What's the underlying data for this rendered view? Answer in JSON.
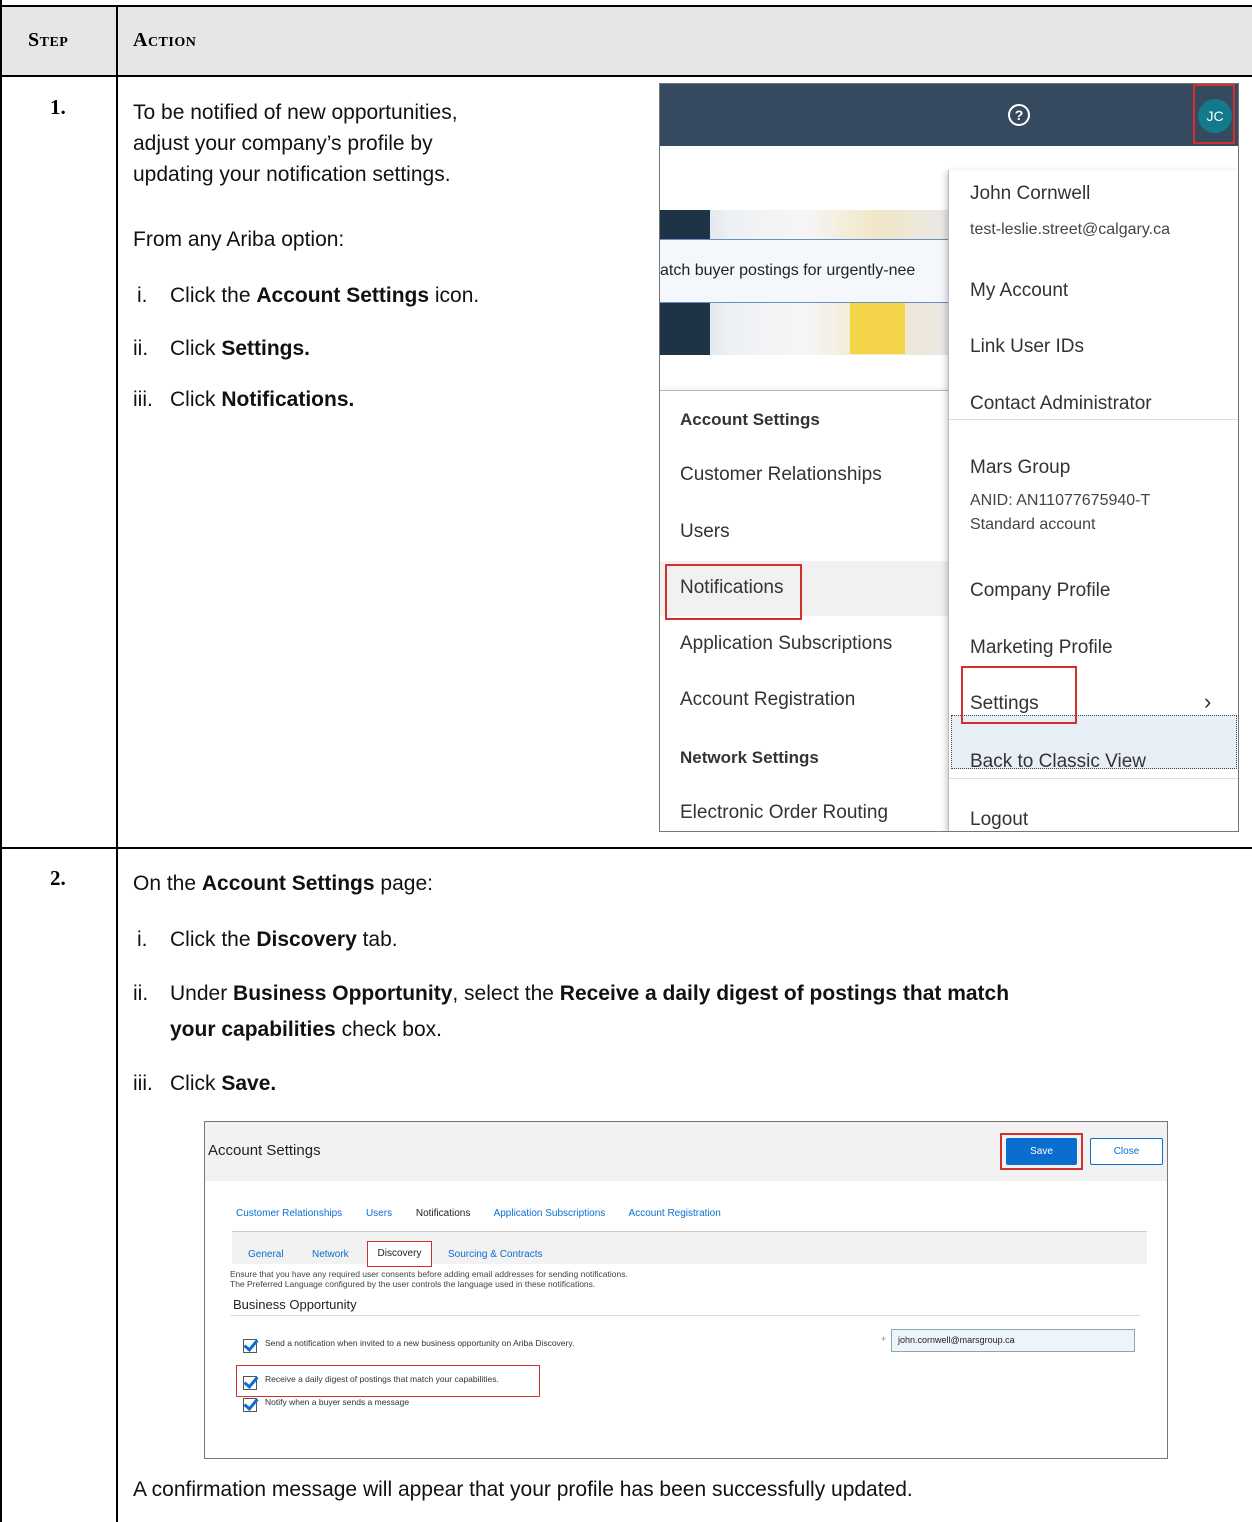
{
  "header": {
    "step": "Step",
    "action": "Action"
  },
  "step1": {
    "number": "1.",
    "intro": [
      "To be notified of new opportunities,",
      "adjust your company’s profile by",
      "updating your notification settings."
    ],
    "from": "From any Ariba option:",
    "i_prefix": "i.",
    "i_pre": "Click the ",
    "i_bold": "Account Settings",
    "i_post": " icon.",
    "ii_prefix": "ii.",
    "ii_pre": "Click ",
    "ii_bold": "Settings.",
    "iii_prefix": "iii.",
    "iii_pre": "Click ",
    "iii_bold": "Notifications.",
    "screenshot": {
      "help_glyph": "?",
      "avatar_initials": "JC",
      "banner_text": "atch buyer postings for urgently-nee",
      "settings_menu": {
        "account_heading": "Account Settings",
        "items": [
          "Customer Relationships",
          "Users",
          "Notifications",
          "Application Subscriptions",
          "Account Registration"
        ],
        "network_heading": "Network Settings",
        "network_items": [
          "Electronic Order Routing"
        ]
      },
      "user_menu": {
        "name": "John Cornwell",
        "email": "test-leslie.street@calgary.ca",
        "my_account": "My Account",
        "link_user_ids": "Link User IDs",
        "contact_admin": "Contact Administrator",
        "company": "Mars Group",
        "anid": "ANID: AN11077675940-T",
        "account_type": "Standard account",
        "company_profile": "Company Profile",
        "marketing_profile": "Marketing Profile",
        "settings": "Settings",
        "chevron": "›",
        "classic_view": "Back to Classic View",
        "logout": "Logout"
      }
    }
  },
  "step2": {
    "number": "2.",
    "line1_pre": "On the ",
    "line1_bold": "Account Settings",
    "line1_post": " page:",
    "i_prefix": "i.",
    "i_pre": "Click the ",
    "i_bold": "Discovery",
    "i_post": " tab.",
    "ii_prefix": "ii.",
    "ii_pre": "Under ",
    "ii_bold1": "Business Opportunity",
    "ii_mid": ", select the ",
    "ii_bold2": "Receive a daily digest of postings that match",
    "ii_line2_bold": "your capabilities",
    "ii_line2_post": " check box.",
    "iii_prefix": "iii.",
    "iii_pre": "Click ",
    "iii_bold": "Save.",
    "confirm": "A confirmation message will appear that your profile has been successfully updated.",
    "screenshot": {
      "title": "Account Settings",
      "save": "Save",
      "close": "Close",
      "tabs": [
        "Customer Relationships",
        "Users",
        "Notifications",
        "Application Subscriptions",
        "Account Registration"
      ],
      "subtabs": [
        "General",
        "Network",
        "Discovery",
        "Sourcing & Contracts"
      ],
      "note1": "Ensure that you have any required user consents before adding email addresses for sending notifications.",
      "note2": "The Preferred Language configured by the user controls the language used in these notifications.",
      "section": "Business Opportunity",
      "cb1": "Send a notification when invited to a new business opportunity on Ariba Discovery.",
      "email_plus": "+",
      "email": "john.cornwell@marsgroup.ca",
      "cb2": "Receive a daily digest of postings that match your capabilities.",
      "cb3": "Notify when a buyer sends a message"
    }
  }
}
